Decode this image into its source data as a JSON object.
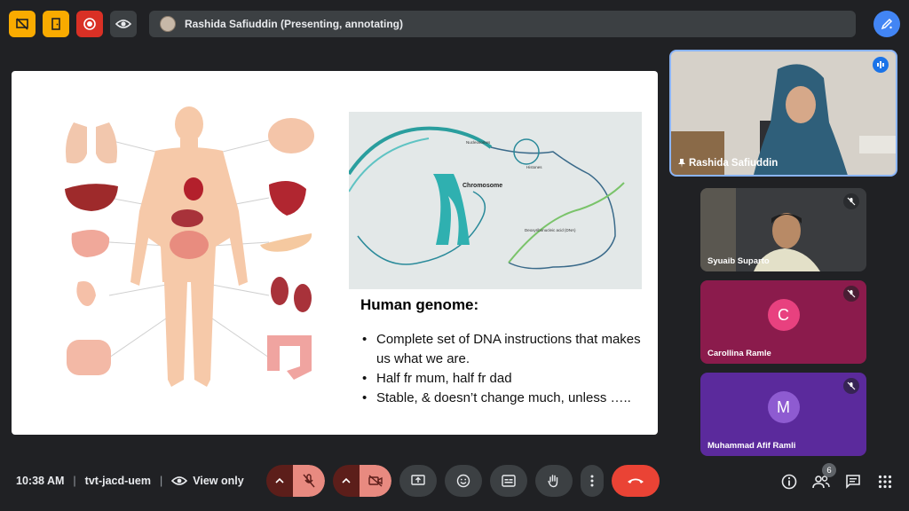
{
  "topbar": {
    "presenter_text": "Rashida Safiuddin (Presenting, annotating)",
    "icons": [
      "present-to-all-off-icon",
      "door-exit-icon",
      "record-icon",
      "eye-icon",
      "annotate-pen-icon"
    ]
  },
  "slide": {
    "genome_title": "Human genome:",
    "bullets": [
      "Complete set of DNA instructions that makes us what we are.",
      "Half fr mum, half fr dad",
      "Stable, & doesn’t change much, unless ….."
    ],
    "dna_labels": {
      "nucleosomes": "Nucleosomes",
      "histones": "Histones",
      "chromosome": "Chromosome",
      "dna": "Deoxyribonucleic acid (DNA)"
    }
  },
  "participants": [
    {
      "name": "Rashida Safiuddin",
      "status": "speaking"
    },
    {
      "name": "Syuaib Suparto",
      "status": "muted"
    },
    {
      "name": "Carollina Ramle",
      "status": "muted",
      "initial": "C"
    },
    {
      "name": "Muhammad Afif Ramli",
      "status": "muted",
      "initial": "M"
    }
  ],
  "bottombar": {
    "time": "10:38 AM",
    "separator": "|",
    "meeting_code": "tvt-jacd-uem",
    "view_only_label": "View only",
    "people_count": "6"
  },
  "colors": {
    "background": "#202124",
    "end_call": "#ea4335",
    "accent_blue": "#1a73e8",
    "muted_control": "#e88a80"
  }
}
